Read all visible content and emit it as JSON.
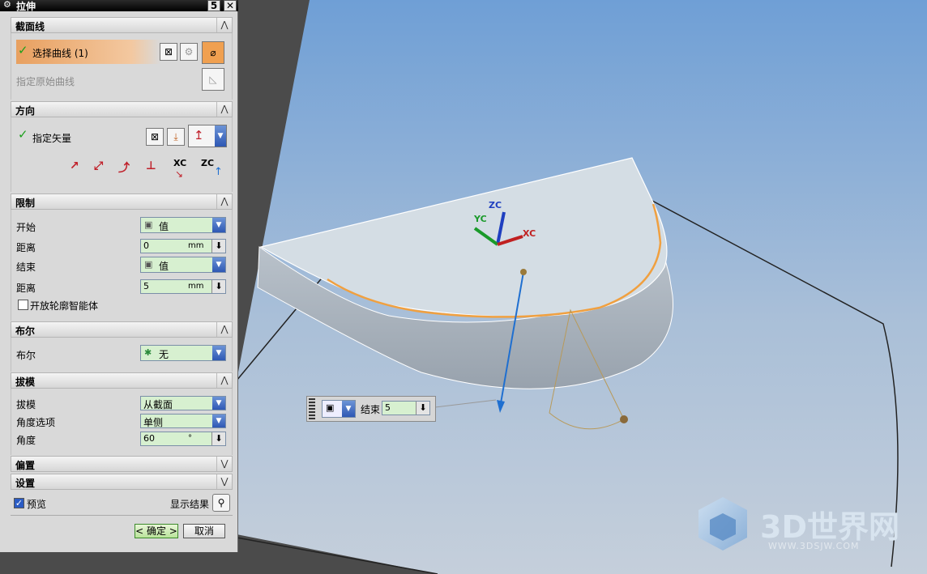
{
  "dialog": {
    "title": "拉伸",
    "title_buttons": [
      "5",
      "✕"
    ],
    "sections": {
      "section_curve": {
        "header": "截面线",
        "select_curve_label": "选择曲线 (1)",
        "specify_origin_label": "指定原始曲线"
      },
      "direction": {
        "header": "方向",
        "specify_vector_label": "指定矢量",
        "vector_options": [
          "XC",
          "ZC"
        ]
      },
      "limits": {
        "header": "限制",
        "start_label": "开始",
        "start_value": "值",
        "start_distance_label": "距离",
        "start_distance": "0",
        "start_unit": "mm",
        "end_label": "结束",
        "end_value": "值",
        "end_distance_label": "距离",
        "end_distance": "5",
        "end_unit": "mm",
        "open_profile_label": "开放轮廓智能体"
      },
      "boolean": {
        "header": "布尔",
        "boolean_label": "布尔",
        "boolean_value": "无"
      },
      "draft": {
        "header": "拔模",
        "draft_label": "拔模",
        "draft_value": "从截面",
        "angle_option_label": "角度选项",
        "angle_option_value": "单侧",
        "angle_label": "角度",
        "angle_value": "60",
        "angle_unit": "°"
      },
      "offset": {
        "header": "偏置"
      },
      "settings": {
        "header": "设置"
      }
    },
    "preview_label": "预览",
    "show_result_label": "显示结果",
    "ok_label": "< 确定 >",
    "cancel_label": "取消"
  },
  "viewport": {
    "axis_labels": {
      "zc": "ZC",
      "yc": "YC",
      "xc": "XC"
    },
    "floating_end_label": "结束",
    "floating_end_value": "5"
  },
  "watermark": {
    "brand": "3D世界网",
    "url": "WWW.3DSJW.COM"
  },
  "colors": {
    "accent_orange": "#e8a060",
    "check_green": "#1ca01c",
    "vector_red": "#c0202a",
    "axis_blue": "#1f6fd0"
  }
}
